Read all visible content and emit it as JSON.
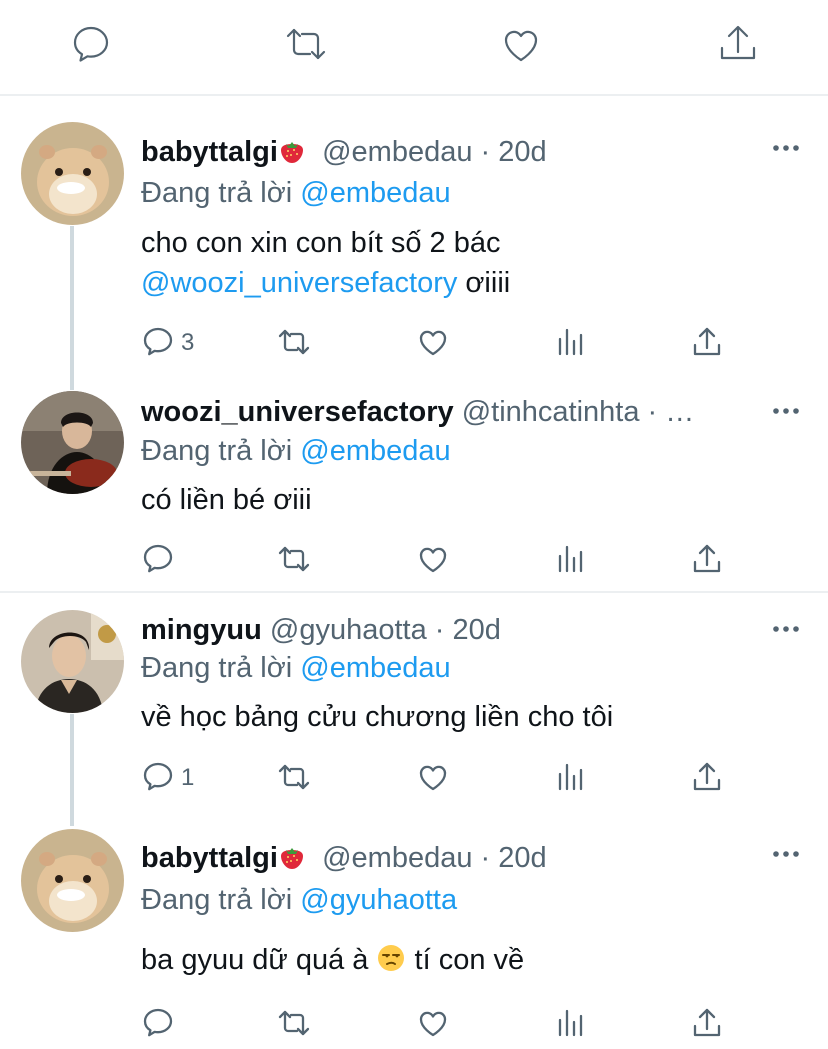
{
  "topbar": {
    "icons": [
      "reply-icon",
      "retweet-icon",
      "like-icon",
      "share-icon"
    ]
  },
  "tweets": [
    {
      "display_name": "babyttalgi",
      "name_emoji": "strawberry",
      "handle_time": "@embedau · 20d",
      "replying_prefix": "Đang trả lời",
      "replying_to": "@embedau",
      "text_part1": "cho con xin con bít số 2 bác",
      "mention": "@woozi_universefactory",
      "text_part2": " ơiiii",
      "reply_count": "3"
    },
    {
      "display_name": "woozi_universefactory",
      "handle_time": "@tinhcatinhta · …",
      "replying_prefix": "Đang trả lời",
      "replying_to": "@embedau",
      "text": "có liền bé ơiii",
      "reply_count": ""
    },
    {
      "display_name": "mingyuu",
      "handle_time": "@gyuhaotta · 20d",
      "replying_prefix": "Đang trả lời",
      "replying_to": "@embedau",
      "text": "về học bảng cửu chương liền cho tôi",
      "reply_count": "1"
    },
    {
      "display_name": "babyttalgi",
      "name_emoji": "strawberry",
      "handle_time": "@embedau · 20d",
      "replying_prefix": "Đang trả lời",
      "replying_to": "@gyuhaotta",
      "text_before_emoji": "ba gyuu dữ quá à ",
      "text_emoji": "unamused-face",
      "text_after_emoji": " tí con về",
      "reply_count": ""
    }
  ],
  "colors": {
    "link": "#1d9bf0",
    "secondary_text": "#536471",
    "thread_line": "#cfd9de",
    "separator": "#eceff1"
  }
}
